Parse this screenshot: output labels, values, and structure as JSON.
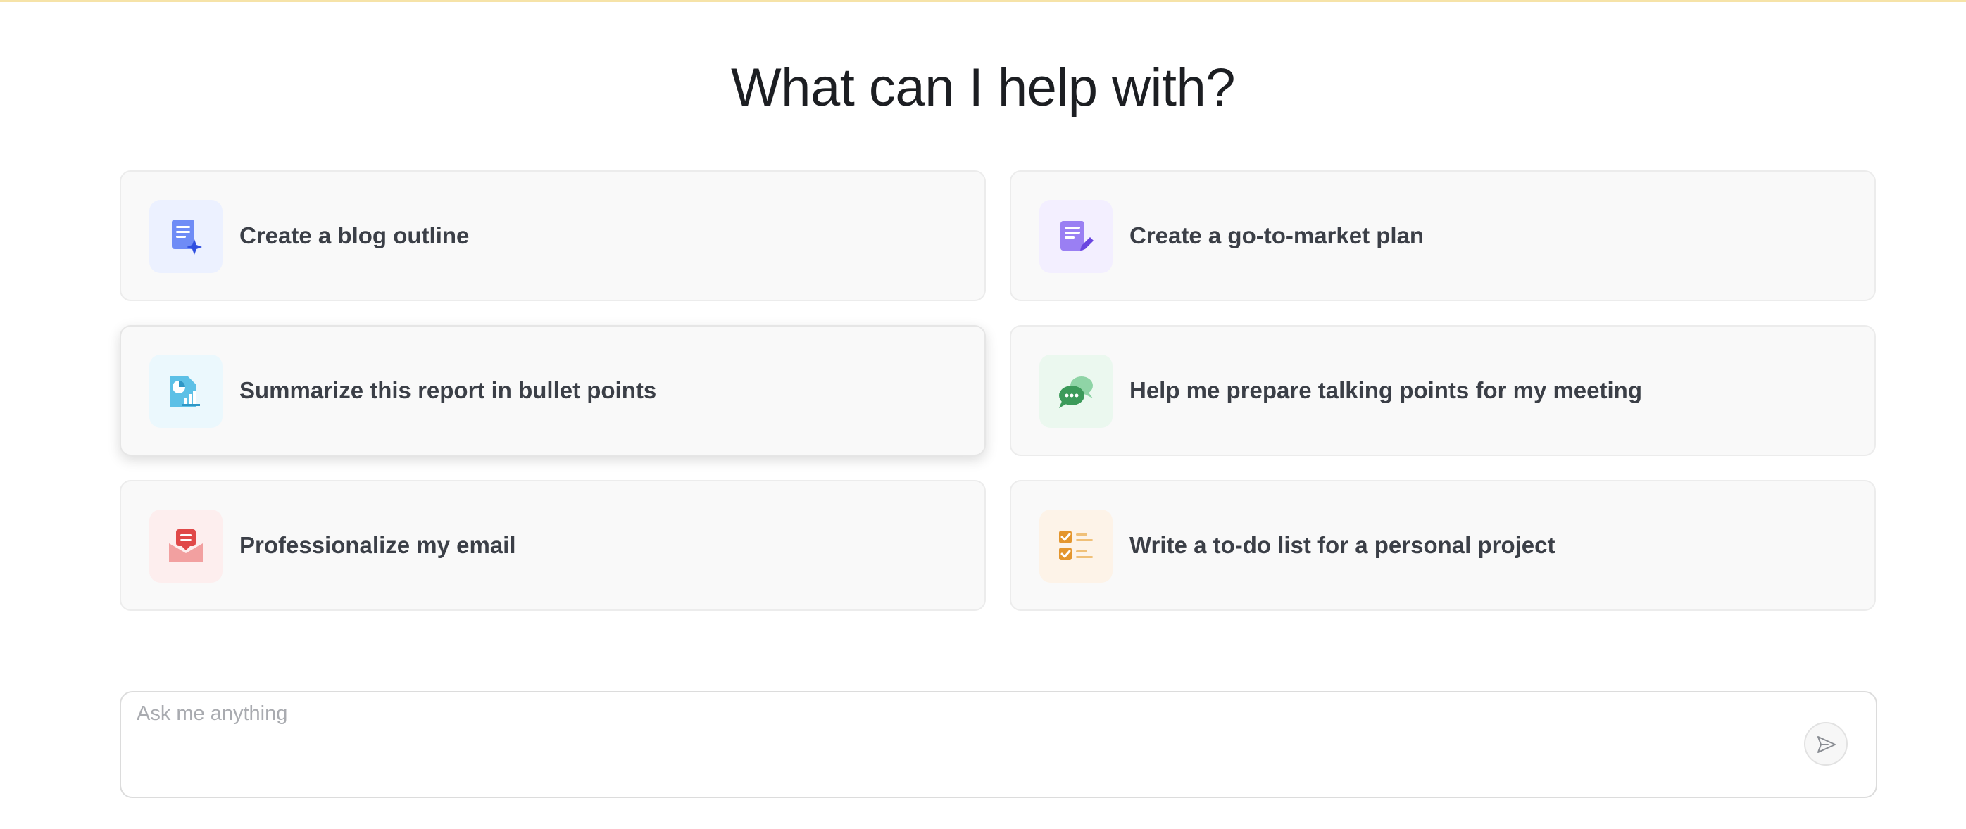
{
  "title": "What can I help with?",
  "suggestions": [
    {
      "label": "Create a blog outline",
      "icon": "blog-outline-icon",
      "icon_bg": "#ecf1ff",
      "icon_color": "#5b7cf5"
    },
    {
      "label": "Create a go-to-market plan",
      "icon": "plan-document-icon",
      "icon_bg": "#f3efff",
      "icon_color": "#8b6cf2"
    },
    {
      "label": "Summarize this report in bullet points",
      "icon": "report-chart-icon",
      "icon_bg": "#ebf8fd",
      "icon_color": "#37a9da"
    },
    {
      "label": "Help me prepare talking points for my meeting",
      "icon": "chat-bubbles-icon",
      "icon_bg": "#ebf8ef",
      "icon_color": "#3c9a5a"
    },
    {
      "label": "Professionalize my email",
      "icon": "email-envelope-icon",
      "icon_bg": "#fdeeee",
      "icon_color": "#e04848"
    },
    {
      "label": "Write a to-do list for a personal project",
      "icon": "checklist-icon",
      "icon_bg": "#fdf3e8",
      "icon_color": "#e4962e"
    }
  ],
  "prompt": {
    "placeholder": "Ask me anything",
    "value": ""
  },
  "colors": {
    "top_line": "#f6e3a8",
    "card_bg": "#f9f9f9",
    "text": "#3b3f47"
  }
}
